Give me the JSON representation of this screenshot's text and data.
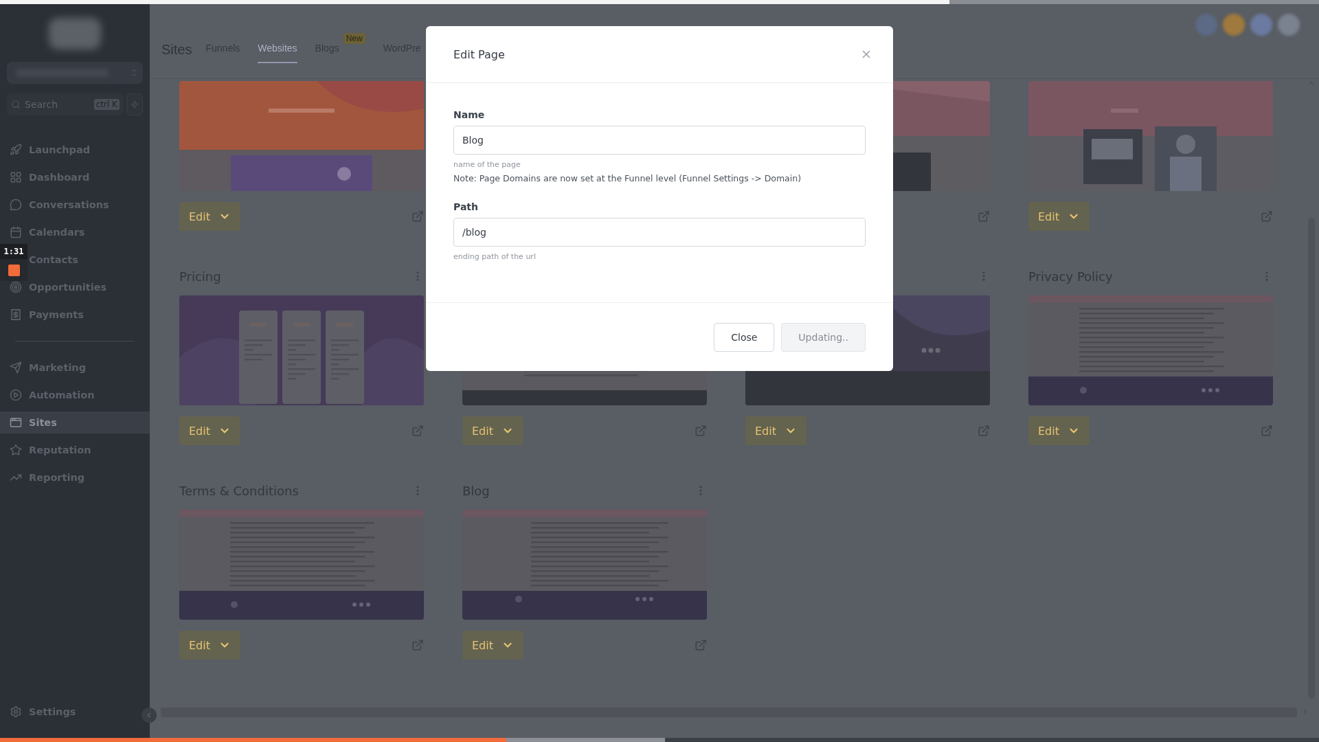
{
  "recorder": {
    "time": "1:31"
  },
  "sidebar": {
    "search": {
      "placeholder": "Search",
      "shortcut": "ctrl K"
    },
    "nav_primary": [
      {
        "label": "Launchpad",
        "selected": false
      },
      {
        "label": "Dashboard",
        "selected": false
      },
      {
        "label": "Conversations",
        "selected": false
      },
      {
        "label": "Calendars",
        "selected": false
      },
      {
        "label": "Contacts",
        "selected": false
      },
      {
        "label": "Opportunities",
        "selected": false
      },
      {
        "label": "Payments",
        "selected": false
      }
    ],
    "nav_secondary": [
      {
        "label": "Marketing",
        "selected": false
      },
      {
        "label": "Automation",
        "selected": false
      },
      {
        "label": "Sites",
        "selected": true
      },
      {
        "label": "Reputation",
        "selected": false
      },
      {
        "label": "Reporting",
        "selected": false
      }
    ],
    "settings": "Settings"
  },
  "header": {
    "title": "Sites",
    "tabs": [
      {
        "label": "Funnels",
        "selected": false
      },
      {
        "label": "Websites",
        "selected": true
      },
      {
        "label": "Blogs",
        "selected": false,
        "badge": "New"
      },
      {
        "label": "WordPre",
        "selected": false
      }
    ]
  },
  "cards": [
    {
      "thumbnail": {
        "kind": "picture"
      },
      "edit": "Edit"
    },
    {
      "thumbnail": {
        "kind": "picture"
      }
    },
    {
      "thumbnail": {
        "kind": "picture"
      },
      "edit": "Edit"
    },
    {
      "title": "Pricing",
      "thumbnail": {
        "kind": "picture"
      },
      "edit": "Edit"
    },
    {
      "thumbnail": {
        "kind": "picture"
      },
      "edit": "Edit"
    },
    {
      "has_menu": true,
      "thumbnail": {
        "kind": "picture"
      },
      "edit": "Edit"
    },
    {
      "title": "Privacy Policy",
      "thumbnail": {
        "kind": "picture"
      },
      "edit": "Edit"
    },
    {
      "title": "Terms & Conditions",
      "thumbnail": {
        "kind": "picture"
      },
      "edit": "Edit"
    },
    {
      "title": "Blog",
      "thumbnail": {
        "kind": "picture"
      },
      "edit": "Edit"
    }
  ],
  "dialog": {
    "title": "Edit Page",
    "fields": [
      {
        "label": "Name",
        "value": "Blog",
        "help": "name of the page",
        "note": "Note: Page Domains are now set at the Funnel level (Funnel Settings -> Domain)"
      },
      {
        "label": "Path",
        "value": "/blog",
        "help": "ending path of the url"
      }
    ],
    "buttons": [
      {
        "label": "Close",
        "kind": "secondary",
        "disabled": false
      },
      {
        "label": "Updating..",
        "kind": "primary",
        "disabled": true
      }
    ]
  },
  "progress": {
    "level": 0.384
  }
}
